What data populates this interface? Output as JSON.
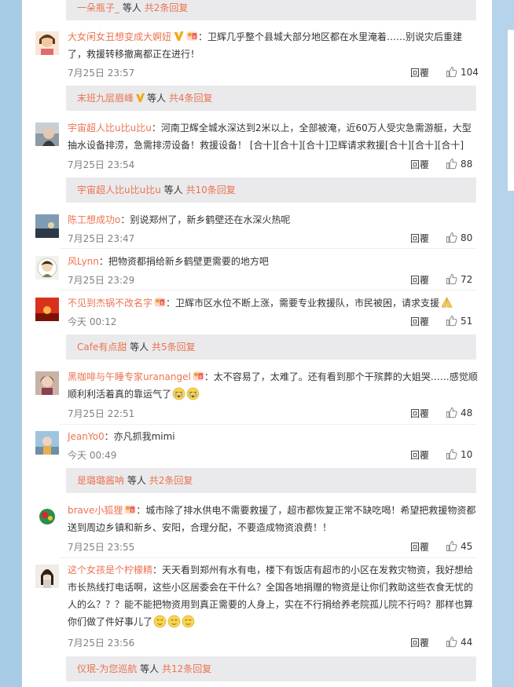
{
  "colors": {
    "accent": "#eb7350",
    "page_bg": "#a9cce6",
    "reply_bg": "#eaeaec"
  },
  "icons": {
    "like": "thumb-up-icon",
    "vip": "vip-v-icon",
    "fan_badge": "fan-badge-icon"
  },
  "reply_boxes": [
    {
      "name": "一朵瓶子_",
      "vb": "等人",
      "count": "共2条回复"
    },
    {
      "name": "末班九层眉峰",
      "vb": "等人",
      "count": "共4条回复"
    },
    {
      "name": "宇宙超人比u比u比u",
      "vb": "等人",
      "count": "共10条回复"
    },
    {
      "name": "Cafe有点甜",
      "vb": "等人",
      "count": "共5条回复"
    },
    {
      "name": "是璐璐酱呐",
      "vb": "等人",
      "count": "共2条回复"
    },
    {
      "name": "仪珉-为您巡航",
      "vb": "等人",
      "count": "共12条回复"
    }
  ],
  "comments": [
    {
      "user": "大女闲女丑想变成大婀妞",
      "text": "：卫辉几乎整个县城大部分地区都在水里淹着……别说灾后重建了，救援转移撤离都正在进行！",
      "time": "7月25日 23:57",
      "reply": "回覆",
      "likes": "104"
    },
    {
      "user": "宇宙超人比u比u比u",
      "text": "：河南卫辉全城水深达到2米以上，全部被淹，近60万人受灾急需游艇，大型抽水设备排涝，急需排涝设备！救援设备！ [合十][合十][合十]卫辉请求救援[合十][合十][合十]",
      "time": "7月25日 23:54",
      "reply": "回覆",
      "likes": "88"
    },
    {
      "user": "陈工想成功o",
      "text": "：别说郑州了，新乡鹤壁还在水深火热呢",
      "time": "7月25日 23:47",
      "reply": "回覆",
      "likes": "80"
    },
    {
      "user": "风Lynn",
      "text": "：把物资都捐给新乡鹤壁更需要的地方吧",
      "time": "7月25日 23:29",
      "reply": "回覆",
      "likes": "72"
    },
    {
      "user": "不见到杰锅不改名字",
      "text": "：卫辉市区水位不断上涨，需要专业救援队，市民被困，请求支援",
      "time": "今天 00:12",
      "reply": "回覆",
      "likes": "51"
    },
    {
      "user": "黑咖啡与午睡专家uranangel",
      "text": "：太不容易了，太难了。还有看到那个干殡葬的大姐哭……感觉顺顺利利活着真的靠运气了",
      "time": "7月25日 22:51",
      "reply": "回覆",
      "likes": "48"
    },
    {
      "user": "JeanYo0",
      "text": "：亦凡抓我mimi",
      "time": "今天 00:49",
      "reply": "回覆",
      "likes": "10"
    },
    {
      "user": "brave小狐狸",
      "text": "：城市除了排水供电不需要救援了，超市都恢复正常不缺吃喝！希望把救援物资都送到周边乡镇和新乡、安阳，合理分配，不要造成物资浪费！！",
      "time": "7月25日 23:55",
      "reply": "回覆",
      "likes": "45"
    },
    {
      "user": "这个女孩是个柠檬精",
      "text": "：天天看到郑州有水有电，楼下有饭店有超市的小区在发救灾物资，我好想给市长热线打电话啊，这些小区居委会在干什么？全国各地捐赠的物资是让你们救助这些衣食无忧的人的么？？？能不能把物资用到真正需要的人身上，实在不行捐给养老院孤儿院不行吗？那样也算你们做了件好事儿了",
      "time": "7月25日 23:56",
      "reply": "回覆",
      "likes": "44"
    }
  ]
}
